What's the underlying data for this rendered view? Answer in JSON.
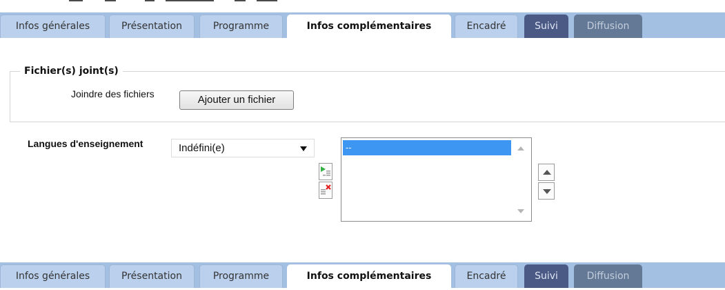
{
  "tabs": [
    {
      "label": "Infos générales",
      "state": "normal"
    },
    {
      "label": "Présentation",
      "state": "normal"
    },
    {
      "label": "Programme",
      "state": "normal"
    },
    {
      "label": "Infos complémentaires",
      "state": "active"
    },
    {
      "label": "Encadré",
      "state": "normal"
    },
    {
      "label": "Suivi",
      "state": "suivi"
    },
    {
      "label": "Diffusion",
      "state": "diffusion"
    }
  ],
  "files_section": {
    "legend": "Fichier(s) joint(s)",
    "join_label": "Joindre des fichiers",
    "add_button": "Ajouter un fichier"
  },
  "languages": {
    "label": "Langues d'enseignement",
    "select_value": "Indéfini(e)",
    "list_items": [
      "--"
    ],
    "selected_index": 0,
    "list_selected_color": "#3c96f2"
  },
  "colors": {
    "tabbar": "#a3bfe2",
    "tab_normal": "#bad0ec",
    "tab_suivi": "#4b5a85",
    "tab_diffusion": "#637996"
  }
}
